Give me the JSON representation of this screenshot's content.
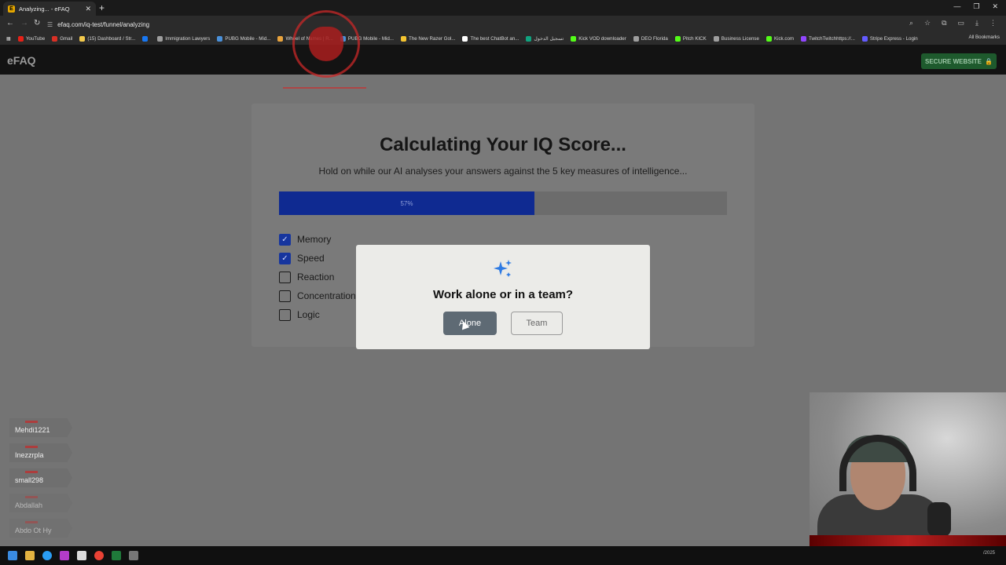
{
  "browser": {
    "tab_title": "Analyzing... - eFAQ",
    "tab_favicon": "E",
    "url": "efaq.com/iq-test/funnel/analyzing",
    "all_bookmarks": "All Bookmarks",
    "bookmarks": [
      {
        "label": "YouTube",
        "color": "#e62117"
      },
      {
        "label": "Gmail",
        "color": "#d93025"
      },
      {
        "label": "(15) Dashboard / Str...",
        "color": "#f2c94c"
      },
      {
        "label": "",
        "color": "#1877f2"
      },
      {
        "label": "Immigration Lawyers",
        "color": "#9e9e9e"
      },
      {
        "label": "PUBG Mobile - Mid...",
        "color": "#4a90d9"
      },
      {
        "label": "Wheel of Names | R...",
        "color": "#e8a33d"
      },
      {
        "label": "PUBG Mobile - Mid...",
        "color": "#4a90d9"
      },
      {
        "label": "The New Razer Gol...",
        "color": "#f4c430"
      },
      {
        "label": "The best ChatBot an...",
        "color": "#ffffff"
      },
      {
        "label": "تسجيل الدخول",
        "color": "#10a37f"
      },
      {
        "label": "Kick VOD downloader",
        "color": "#53fc18"
      },
      {
        "label": "DEO Florida",
        "color": "#9e9e9e"
      },
      {
        "label": "Pitch KICK",
        "color": "#53fc18"
      },
      {
        "label": "Business License",
        "color": "#9e9e9e"
      },
      {
        "label": "Kick.com",
        "color": "#53fc18"
      },
      {
        "label": "TwitchTwitchhttps://...",
        "color": "#9146ff"
      },
      {
        "label": "Stripe Express - Login",
        "color": "#635bff"
      }
    ]
  },
  "site": {
    "logo": "eFAQ",
    "secure_label": "SECURE WEBSITE",
    "secure_icon": "lock-icon"
  },
  "analysis": {
    "title": "Calculating Your IQ Score...",
    "subtitle": "Hold on while our AI analyses your answers against the 5 key measures of intelligence...",
    "progress": 0.57,
    "progress_label": "57%",
    "measures": [
      {
        "label": "Memory",
        "checked": true
      },
      {
        "label": "Speed",
        "checked": true
      },
      {
        "label": "Reaction",
        "checked": false
      },
      {
        "label": "Concentration",
        "checked": false
      },
      {
        "label": "Logic",
        "checked": false
      }
    ]
  },
  "modal": {
    "icon": "sparkle-icon",
    "question": "Work alone or in a team?",
    "option_alone": "Alone",
    "option_team": "Team"
  },
  "stream_chat": [
    {
      "name": "Mehdi1221",
      "faded": false
    },
    {
      "name": "Inezzrpla",
      "faded": false
    },
    {
      "name": "small298",
      "faded": false
    },
    {
      "name": "Abdallah",
      "faded": true
    },
    {
      "name": "Abdo Ot Hy",
      "faded": true
    }
  ],
  "tray": {
    "date": "/2025"
  }
}
